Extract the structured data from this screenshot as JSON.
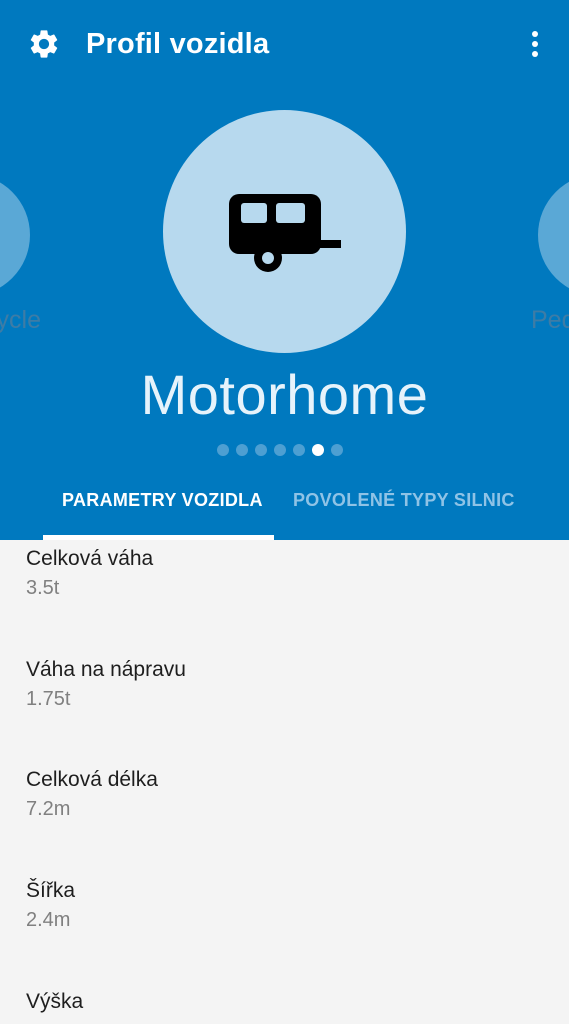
{
  "toolbar": {
    "title": "Profil vozidla",
    "settings_icon": "gear-icon",
    "menu_icon": "more-vert-icon"
  },
  "carousel": {
    "prev_label": "Bicycle",
    "next_label": "Pedestrian",
    "current_label": "Motorhome",
    "current_icon": "caravan-icon",
    "page_count": 7,
    "active_index": 5
  },
  "tabs": [
    {
      "label": "PARAMETRY VOZIDLA",
      "selected": true
    },
    {
      "label": "POVOLENÉ TYPY SILNIC",
      "selected": false
    }
  ],
  "parameters": [
    {
      "label": "Celková váha",
      "value": "3.5t"
    },
    {
      "label": "Váha na nápravu",
      "value": "1.75t"
    },
    {
      "label": "Celková délka",
      "value": "7.2m"
    },
    {
      "label": "Šířka",
      "value": "2.4m"
    },
    {
      "label": "Výška",
      "value": ""
    }
  ],
  "colors": {
    "header_bg": "#0079bf",
    "circle_bg": "#b7d9ee",
    "content_bg": "#f4f4f4"
  }
}
